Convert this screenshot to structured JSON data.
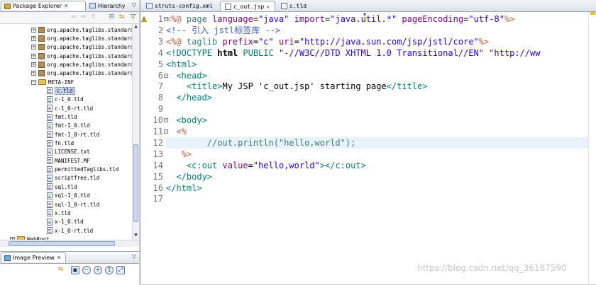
{
  "left": {
    "tabs": [
      {
        "label": "Package Explorer"
      },
      {
        "label": "Hierarchy"
      }
    ],
    "tree": [
      {
        "label": "org.apache.taglibs.standard",
        "kind": "jar",
        "indent": 44,
        "expander": "+"
      },
      {
        "label": "org.apache.taglibs.standard",
        "kind": "jar",
        "indent": 44,
        "expander": "+"
      },
      {
        "label": "org.apache.taglibs.standard",
        "kind": "jar",
        "indent": 44,
        "expander": "+"
      },
      {
        "label": "org.apache.taglibs.standard",
        "kind": "jar",
        "indent": 44,
        "expander": "+"
      },
      {
        "label": "org.apache.taglibs.standard",
        "kind": "jar",
        "indent": 44,
        "expander": "+"
      },
      {
        "label": "org.apache.taglibs.standard",
        "kind": "jar",
        "indent": 44,
        "expander": "+"
      },
      {
        "label": "META-INF",
        "kind": "folder",
        "indent": 44,
        "expander": "−"
      },
      {
        "label": "c.tld",
        "kind": "file",
        "indent": 66,
        "selected": true
      },
      {
        "label": "c-1_0.tld",
        "kind": "file",
        "indent": 66
      },
      {
        "label": "c-1_0-rt.tld",
        "kind": "file",
        "indent": 66
      },
      {
        "label": "fmt.tld",
        "kind": "file",
        "indent": 66
      },
      {
        "label": "fmt-1_0.tld",
        "kind": "file",
        "indent": 66
      },
      {
        "label": "fmt-1_0-rt.tld",
        "kind": "file",
        "indent": 66
      },
      {
        "label": "fn.tld",
        "kind": "file",
        "indent": 66
      },
      {
        "label": "LICENSE.txt",
        "kind": "file",
        "indent": 66
      },
      {
        "label": "MANIFEST.MF",
        "kind": "file",
        "indent": 66
      },
      {
        "label": "permittedTaglibs.tld",
        "kind": "file",
        "indent": 66
      },
      {
        "label": "scriptfree.tld",
        "kind": "file",
        "indent": 66
      },
      {
        "label": "sql.tld",
        "kind": "file",
        "indent": 66
      },
      {
        "label": "sql-1_0.tld",
        "kind": "file",
        "indent": 66
      },
      {
        "label": "sql-1_0-rt.tld",
        "kind": "file",
        "indent": 66
      },
      {
        "label": "x.tld",
        "kind": "file",
        "indent": 66
      },
      {
        "label": "x-1_0.tld",
        "kind": "file",
        "indent": 66
      },
      {
        "label": "x-1_0-rt.tld",
        "kind": "file",
        "indent": 66
      },
      {
        "label": "WebRoot",
        "kind": "folder",
        "indent": 14,
        "expander": "+"
      }
    ],
    "image_preview": {
      "label": "Image Preview"
    }
  },
  "editor": {
    "tabs": [
      {
        "label": "struts-config.xml",
        "active": false
      },
      {
        "label": "c_out.jsp",
        "active": true
      },
      {
        "label": "c.tld",
        "active": false
      }
    ],
    "current_line": 12,
    "lines": [
      {
        "n": "1",
        "tokens": [
          [
            "dir",
            "<%@ "
          ],
          [
            "key",
            "page "
          ],
          [
            "attr",
            "language"
          ],
          [
            "txt",
            "="
          ],
          [
            "val",
            "\"java\""
          ],
          [
            "txt",
            " "
          ],
          [
            "attr",
            "import"
          ],
          [
            "txt",
            "="
          ],
          [
            "val",
            "\"java.util.*\""
          ],
          [
            "txt",
            " "
          ],
          [
            "attr",
            "pageEncoding"
          ],
          [
            "txt",
            "="
          ],
          [
            "val",
            "\"utf-8\""
          ],
          [
            "dir",
            "%>"
          ]
        ]
      },
      {
        "n": "2",
        "tokens": [
          [
            "com",
            "<!-- 引入 jstl标签库 -->"
          ]
        ]
      },
      {
        "n": "3",
        "tokens": [
          [
            "dir",
            "<%@ "
          ],
          [
            "key",
            "taglib "
          ],
          [
            "attr",
            "prefix"
          ],
          [
            "txt",
            "="
          ],
          [
            "val",
            "\"c\""
          ],
          [
            "txt",
            " "
          ],
          [
            "attr",
            "uri"
          ],
          [
            "txt",
            "="
          ],
          [
            "val",
            "\"http://java.sun.com/jsp/jstl/core\""
          ],
          [
            "dir",
            "%>"
          ]
        ]
      },
      {
        "n": "4",
        "tokens": [
          [
            "tag",
            "<!DOCTYPE "
          ],
          [
            "bold",
            "html "
          ],
          [
            "tag",
            "PUBLIC "
          ],
          [
            "val",
            "\"-//W3C//DTD XHTML 1.0 Transitional//EN\""
          ],
          [
            "txt",
            " "
          ],
          [
            "val",
            "\"http://ww"
          ]
        ]
      },
      {
        "n": "5",
        "tokens": [
          [
            "tag",
            "<html>"
          ]
        ]
      },
      {
        "n": "6",
        "tokens": [
          [
            "txt",
            "  "
          ],
          [
            "tag",
            "<head>"
          ]
        ]
      },
      {
        "n": "7",
        "tokens": [
          [
            "txt",
            "    "
          ],
          [
            "tag",
            "<title>"
          ],
          [
            "txt",
            "My JSP 'c_out.jsp' starting page"
          ],
          [
            "tag",
            "</title>"
          ]
        ]
      },
      {
        "n": "8",
        "tokens": [
          [
            "txt",
            "  "
          ],
          [
            "tag",
            "</head>"
          ]
        ]
      },
      {
        "n": "9",
        "tokens": []
      },
      {
        "n": "10",
        "tokens": [
          [
            "txt",
            "  "
          ],
          [
            "tag",
            "<body>"
          ]
        ]
      },
      {
        "n": "11",
        "tokens": [
          [
            "txt",
            "  "
          ],
          [
            "dir",
            "<%"
          ]
        ]
      },
      {
        "n": "12",
        "tokens": [
          [
            "txt",
            "        "
          ],
          [
            "jcom",
            "//out.println(\"hello,world\");"
          ]
        ]
      },
      {
        "n": "13",
        "tokens": [
          [
            "txt",
            "   "
          ],
          [
            "dir",
            "%>"
          ]
        ]
      },
      {
        "n": "14",
        "tokens": [
          [
            "txt",
            "    "
          ],
          [
            "tag",
            "<c:out "
          ],
          [
            "attr",
            "value"
          ],
          [
            "txt",
            "="
          ],
          [
            "val",
            "\"hello,world\""
          ],
          [
            "tag",
            "></c:out>"
          ]
        ]
      },
      {
        "n": "15",
        "tokens": [
          [
            "txt",
            "  "
          ],
          [
            "tag",
            "</body>"
          ]
        ]
      },
      {
        "n": "16",
        "tokens": [
          [
            "tag",
            "</html>"
          ]
        ]
      },
      {
        "n": "17",
        "tokens": []
      }
    ],
    "fold_lines": [
      1,
      6,
      10,
      11
    ],
    "warning_lines": [
      1
    ]
  },
  "watermark": "https://blog.csdn.net/qq_36187590"
}
